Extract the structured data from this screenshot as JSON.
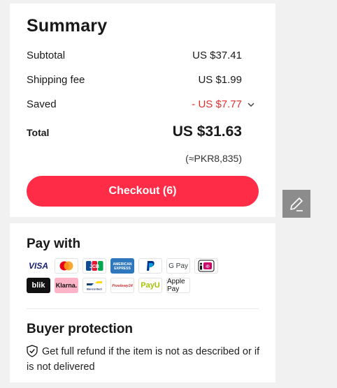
{
  "summary": {
    "title": "Summary",
    "subtotal_label": "Subtotal",
    "subtotal_value": "US $37.41",
    "shipping_label": "Shipping fee",
    "shipping_value": "US $1.99",
    "saved_label": "Saved",
    "saved_value": "- US $7.77",
    "total_label": "Total",
    "total_value": "US $31.63",
    "local_total": "(≈PKR8,835)",
    "checkout_label": "Checkout (6)"
  },
  "pay": {
    "title": "Pay with",
    "methods_row1": [
      "VISA",
      "Mastercard",
      "JCB",
      "American Express",
      "PayPal",
      "G Pay",
      "iDEAL"
    ],
    "methods_row2": [
      "blik",
      "Klarna.",
      "Bancontact",
      "Przelewy24",
      "PayU",
      "Apple Pay"
    ]
  },
  "protection": {
    "title": "Buyer protection",
    "text": "Get full refund if the item is not as described or if is not delivered"
  },
  "colors": {
    "accent": "#fe2c47",
    "saved": "#e52e2e"
  }
}
